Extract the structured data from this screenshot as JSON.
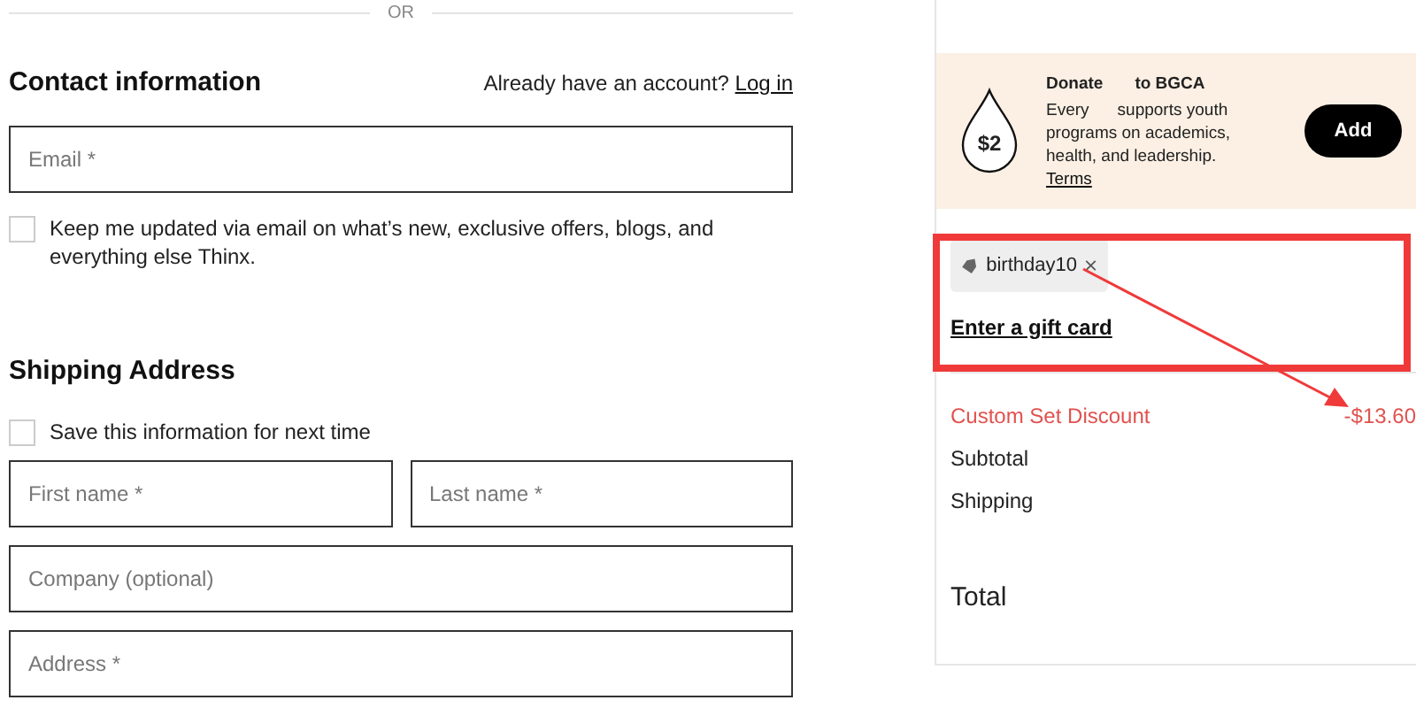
{
  "divider_label": "OR",
  "contact": {
    "title": "Contact information",
    "account_prompt": "Already have an account?",
    "login_link": "Log in",
    "email": {
      "placeholder": "Email *"
    },
    "newsletter": {
      "label": "Keep me updated via email on what’s new, exclusive offers, blogs, and everything else Thinx.",
      "checked": false
    }
  },
  "shipping": {
    "title": "Shipping Address",
    "save_info": {
      "label": "Save this information for next time",
      "checked": false
    },
    "fields": [
      {
        "placeholder": "First name *",
        "half": true
      },
      {
        "placeholder": "Last name *",
        "half": true
      },
      {
        "placeholder": "Company (optional)",
        "half": false
      },
      {
        "placeholder": "Address *",
        "half": false
      }
    ]
  },
  "donation": {
    "badge": "$2",
    "title_parts": [
      "Donate",
      "to BGCA"
    ],
    "body_lead": "Every",
    "body": "supports youth programs on academics, health, and leadership.",
    "terms_link": "Terms",
    "button": "Add"
  },
  "discount_code": {
    "code": "birthday10"
  },
  "gift_card_link": "Enter a gift card",
  "summary": [
    {
      "label": "Custom Set Discount",
      "value": "-$13.60",
      "kind": "discount"
    },
    {
      "label": "Subtotal",
      "kind": "line"
    },
    {
      "label": "Shipping",
      "kind": "line"
    },
    {
      "label": "Total",
      "kind": "total"
    }
  ]
}
